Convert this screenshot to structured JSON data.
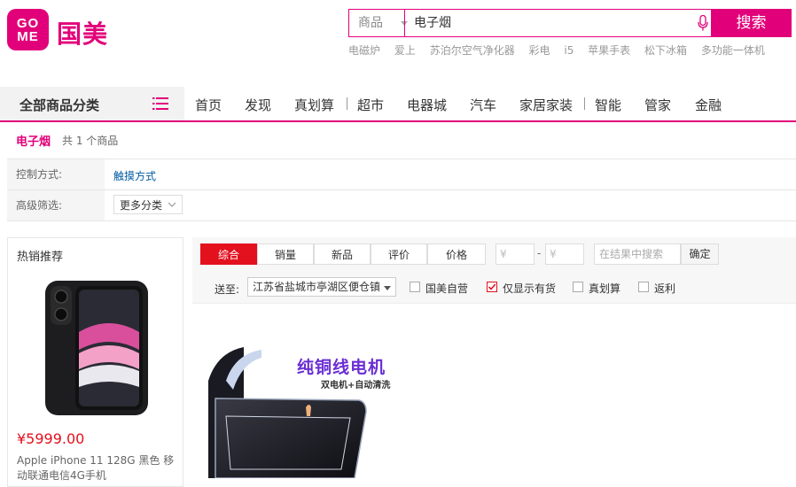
{
  "header": {
    "logo_line1": "GO",
    "logo_line2": "ME",
    "logo_text": "国美",
    "search_category": "商品",
    "search_value": "电子烟",
    "search_button": "搜索",
    "hotwords": [
      "电磁炉",
      "爱上",
      "苏泊尔空气净化器",
      "彩电",
      "i5",
      "苹果手表",
      "松下冰箱",
      "多功能一体机"
    ]
  },
  "nav": {
    "all_categories": "全部商品分类",
    "items": [
      "首页",
      "发现",
      "真划算",
      "超市",
      "电器城",
      "汽车",
      "家居家装",
      "智能",
      "管家",
      "金融"
    ]
  },
  "breadcrumb": {
    "keyword": "电子烟",
    "count_text": "共 1 个商品"
  },
  "filters": {
    "control_label": "控制方式:",
    "control_value": "触摸方式",
    "advanced_label": "高级筛选:",
    "more_button": "更多分类"
  },
  "hot": {
    "title": "热销推荐",
    "price": "¥5999.00",
    "name": "Apple iPhone 11 128G 黑色 移动联通电信4G手机"
  },
  "sort": {
    "tabs": [
      "综合",
      "销量",
      "新品",
      "评价",
      "价格"
    ],
    "active_tab": "综合",
    "price_min_placeholder": "¥",
    "price_max_placeholder": "¥",
    "price_dash": "-",
    "within_placeholder": "在结果中搜索",
    "confirm": "确定",
    "deliver_label": "送至:",
    "deliver_value": "江苏省盐城市亭湖区便仓镇",
    "checkboxes": [
      {
        "label": "国美自营",
        "checked": false
      },
      {
        "label": "仅显示有货",
        "checked": true
      },
      {
        "label": "真划算",
        "checked": false
      },
      {
        "label": "返利",
        "checked": false
      }
    ]
  },
  "product": {
    "image_title": "纯铜线电机",
    "image_subtitle": "双电机+自动清洗"
  },
  "colors": {
    "brand": "#e2007a",
    "price_red": "#e3101e",
    "promo_purple": "#6a2ed2"
  }
}
